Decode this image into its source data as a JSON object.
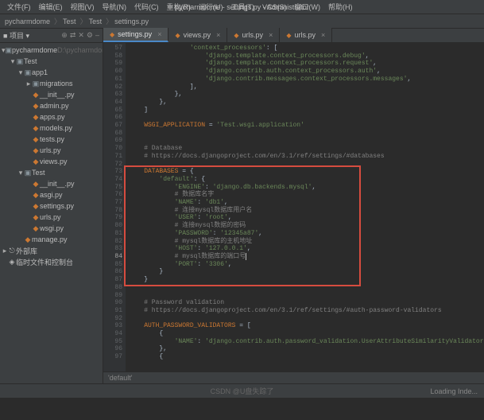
{
  "window": {
    "title": "pycharmdome - settings.py - Administrator"
  },
  "menu": {
    "items": [
      "文件(F)",
      "编辑(E)",
      "视图(V)",
      "导航(N)",
      "代码(C)",
      "重构(R)",
      "运行(U)",
      "工具(T)",
      "VCS(S)",
      "窗口(W)",
      "帮助(H)"
    ]
  },
  "breadcrumb": {
    "items": [
      "pycharmdome",
      "Test",
      "Test",
      "settings.py"
    ]
  },
  "sidebar": {
    "title": "项目",
    "icons": [
      "⊕",
      "⇄",
      "✕",
      "⚙",
      "–"
    ],
    "tree": [
      {
        "d": 0,
        "t": "folder",
        "tw": "▾",
        "label": "pycharmdome",
        "hint": "D:\\pycharmdome"
      },
      {
        "d": 1,
        "t": "folder",
        "tw": "▾",
        "label": "Test"
      },
      {
        "d": 2,
        "t": "folder",
        "tw": "▾",
        "label": "app1"
      },
      {
        "d": 3,
        "t": "folder",
        "tw": "▸",
        "label": "migrations"
      },
      {
        "d": 3,
        "t": "py",
        "tw": "",
        "label": "__init__.py"
      },
      {
        "d": 3,
        "t": "py",
        "tw": "",
        "label": "admin.py"
      },
      {
        "d": 3,
        "t": "py",
        "tw": "",
        "label": "apps.py"
      },
      {
        "d": 3,
        "t": "py",
        "tw": "",
        "label": "models.py"
      },
      {
        "d": 3,
        "t": "py",
        "tw": "",
        "label": "tests.py"
      },
      {
        "d": 3,
        "t": "py",
        "tw": "",
        "label": "urls.py"
      },
      {
        "d": 3,
        "t": "py",
        "tw": "",
        "label": "views.py"
      },
      {
        "d": 2,
        "t": "folder",
        "tw": "▾",
        "label": "Test"
      },
      {
        "d": 3,
        "t": "py",
        "tw": "",
        "label": "__init__.py"
      },
      {
        "d": 3,
        "t": "py",
        "tw": "",
        "label": "asgi.py"
      },
      {
        "d": 3,
        "t": "py",
        "tw": "",
        "label": "settings.py"
      },
      {
        "d": 3,
        "t": "py",
        "tw": "",
        "label": "urls.py"
      },
      {
        "d": 3,
        "t": "py",
        "tw": "",
        "label": "wsgi.py"
      },
      {
        "d": 2,
        "t": "py",
        "tw": "",
        "label": "manage.py"
      },
      {
        "d": 0,
        "t": "lib",
        "tw": "▸",
        "label": "外部库"
      },
      {
        "d": 0,
        "t": "scratch",
        "tw": "",
        "label": "临时文件和控制台"
      }
    ]
  },
  "tabs": [
    {
      "label": "settings.py",
      "active": true
    },
    {
      "label": "views.py",
      "active": false
    },
    {
      "label": "urls.py",
      "active": false
    },
    {
      "label": "urls.py",
      "active": false
    }
  ],
  "gutter_start": 57,
  "gutter_current": 84,
  "code_lines": [
    {
      "indent": 16,
      "segs": [
        {
          "c": "s",
          "t": "'context_processors'"
        },
        {
          "c": "p",
          "t": ": ["
        }
      ]
    },
    {
      "indent": 20,
      "segs": [
        {
          "c": "s",
          "t": "'django.template.context_processors.debug'"
        },
        {
          "c": "p",
          "t": ","
        }
      ]
    },
    {
      "indent": 20,
      "segs": [
        {
          "c": "s",
          "t": "'django.template.context_processors.request'"
        },
        {
          "c": "p",
          "t": ","
        }
      ]
    },
    {
      "indent": 20,
      "segs": [
        {
          "c": "s",
          "t": "'django.contrib.auth.context_processors.auth'"
        },
        {
          "c": "p",
          "t": ","
        }
      ]
    },
    {
      "indent": 20,
      "segs": [
        {
          "c": "s",
          "t": "'django.contrib.messages.context_processors.messages'"
        },
        {
          "c": "p",
          "t": ","
        }
      ]
    },
    {
      "indent": 16,
      "segs": [
        {
          "c": "p",
          "t": "],"
        }
      ]
    },
    {
      "indent": 12,
      "segs": [
        {
          "c": "p",
          "t": "},"
        }
      ]
    },
    {
      "indent": 8,
      "segs": [
        {
          "c": "p",
          "t": "},"
        }
      ]
    },
    {
      "indent": 4,
      "segs": [
        {
          "c": "p",
          "t": "]"
        }
      ]
    },
    {
      "indent": 4,
      "segs": []
    },
    {
      "indent": 4,
      "segs": [
        {
          "c": "k",
          "t": "WSGI_APPLICATION"
        },
        {
          "c": "p",
          "t": " = "
        },
        {
          "c": "s",
          "t": "'Test.wsgi.application'"
        }
      ]
    },
    {
      "indent": 4,
      "segs": []
    },
    {
      "indent": 4,
      "segs": []
    },
    {
      "indent": 4,
      "segs": [
        {
          "c": "c",
          "t": "# Database"
        }
      ]
    },
    {
      "indent": 4,
      "segs": [
        {
          "c": "c",
          "t": "# https://docs.djangoproject.com/en/3.1/ref/settings/#databases"
        }
      ]
    },
    {
      "indent": 4,
      "segs": []
    },
    {
      "indent": 4,
      "segs": [
        {
          "c": "k",
          "t": "DATABASES"
        },
        {
          "c": "p",
          "t": " = {"
        }
      ]
    },
    {
      "indent": 8,
      "segs": [
        {
          "c": "s",
          "t": "'default'"
        },
        {
          "c": "p",
          "t": ": {"
        }
      ]
    },
    {
      "indent": 12,
      "segs": [
        {
          "c": "s",
          "t": "'ENGINE'"
        },
        {
          "c": "p",
          "t": ": "
        },
        {
          "c": "s",
          "t": "'django.db.backends.mysql'"
        },
        {
          "c": "p",
          "t": ","
        }
      ]
    },
    {
      "indent": 12,
      "segs": [
        {
          "c": "c",
          "t": "# 数据库名字"
        }
      ]
    },
    {
      "indent": 12,
      "segs": [
        {
          "c": "s",
          "t": "'NAME'"
        },
        {
          "c": "p",
          "t": ": "
        },
        {
          "c": "s",
          "t": "'db1'"
        },
        {
          "c": "p",
          "t": ","
        }
      ]
    },
    {
      "indent": 12,
      "segs": [
        {
          "c": "c",
          "t": "# 连接mysql数据库用户名"
        }
      ]
    },
    {
      "indent": 12,
      "segs": [
        {
          "c": "s",
          "t": "'USER'"
        },
        {
          "c": "p",
          "t": ": "
        },
        {
          "c": "s",
          "t": "'root'"
        },
        {
          "c": "p",
          "t": ","
        }
      ]
    },
    {
      "indent": 12,
      "segs": [
        {
          "c": "c",
          "t": "# 连接mysql数据的密码"
        }
      ]
    },
    {
      "indent": 12,
      "segs": [
        {
          "c": "s",
          "t": "'PASSWORD'"
        },
        {
          "c": "p",
          "t": ": "
        },
        {
          "c": "s",
          "t": "'12345a87'"
        },
        {
          "c": "p",
          "t": ","
        }
      ]
    },
    {
      "indent": 12,
      "segs": [
        {
          "c": "c",
          "t": "# mysql数据库的主机地址"
        }
      ]
    },
    {
      "indent": 12,
      "segs": [
        {
          "c": "s",
          "t": "'HOST'"
        },
        {
          "c": "p",
          "t": ": "
        },
        {
          "c": "s",
          "t": "'127.0.0.1'"
        },
        {
          "c": "p",
          "t": ","
        }
      ]
    },
    {
      "indent": 12,
      "segs": [
        {
          "c": "c",
          "t": "# mysql数据库的端口号"
        }
      ]
    },
    {
      "indent": 12,
      "segs": [
        {
          "c": "s",
          "t": "'PORT'"
        },
        {
          "c": "p",
          "t": ": "
        },
        {
          "c": "s",
          "t": "'3306'"
        },
        {
          "c": "p",
          "t": ","
        }
      ]
    },
    {
      "indent": 8,
      "segs": [
        {
          "c": "p",
          "t": "}"
        }
      ]
    },
    {
      "indent": 4,
      "segs": [
        {
          "c": "p",
          "t": "}"
        }
      ]
    },
    {
      "indent": 4,
      "segs": []
    },
    {
      "indent": 4,
      "segs": []
    },
    {
      "indent": 4,
      "segs": [
        {
          "c": "c",
          "t": "# Password validation"
        }
      ]
    },
    {
      "indent": 4,
      "segs": [
        {
          "c": "c",
          "t": "# https://docs.djangoproject.com/en/3.1/ref/settings/#auth-password-validators"
        }
      ]
    },
    {
      "indent": 4,
      "segs": []
    },
    {
      "indent": 4,
      "segs": [
        {
          "c": "k",
          "t": "AUTH_PASSWORD_VALIDATORS"
        },
        {
          "c": "p",
          "t": " = ["
        }
      ]
    },
    {
      "indent": 8,
      "segs": [
        {
          "c": "p",
          "t": "{"
        }
      ]
    },
    {
      "indent": 12,
      "segs": [
        {
          "c": "s",
          "t": "'NAME'"
        },
        {
          "c": "p",
          "t": ": "
        },
        {
          "c": "s",
          "t": "'django.contrib.auth.password_validation.UserAttributeSimilarityValidator'"
        },
        {
          "c": "p",
          "t": ","
        }
      ]
    },
    {
      "indent": 8,
      "segs": [
        {
          "c": "p",
          "t": "},"
        }
      ]
    },
    {
      "indent": 8,
      "segs": [
        {
          "c": "p",
          "t": "{"
        }
      ]
    }
  ],
  "breadcrumb_code": "'default'",
  "status": {
    "center": "CSDN @U盘失踪了",
    "right": "Loading Inde..."
  }
}
